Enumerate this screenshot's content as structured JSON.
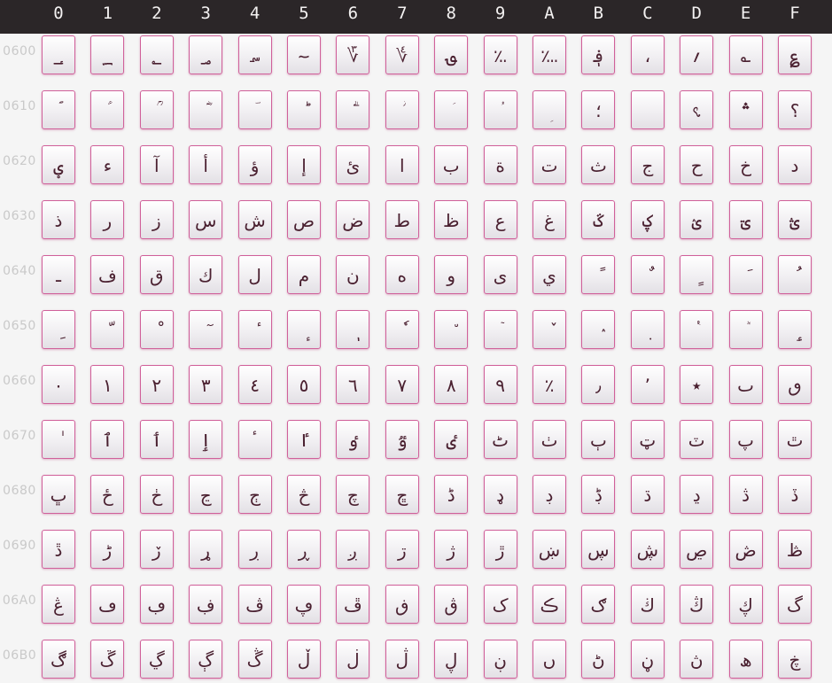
{
  "columns": [
    "0",
    "1",
    "2",
    "3",
    "4",
    "5",
    "6",
    "7",
    "8",
    "9",
    "A",
    "B",
    "C",
    "D",
    "E",
    "F"
  ],
  "rows": [
    {
      "label": "0600",
      "glyphs": [
        "؀",
        "؁",
        "؂",
        "؃",
        "؄",
        "؅",
        "؆",
        "؇",
        "؈",
        "؉",
        "؊",
        "؋",
        "،",
        "؍",
        "؎",
        "؏"
      ]
    },
    {
      "label": "0610",
      "glyphs": [
        "ؐ",
        "ؑ",
        "ؒ",
        "ؓ",
        "ؔ",
        "ؕ",
        "ؖ",
        "ؗ",
        "ؘ",
        "ؙ",
        "ؚ",
        "؛",
        "؜",
        "؝",
        "؞",
        "؟"
      ]
    },
    {
      "label": "0620",
      "glyphs": [
        "ؠ",
        "ء",
        "آ",
        "أ",
        "ؤ",
        "إ",
        "ئ",
        "ا",
        "ب",
        "ة",
        "ت",
        "ث",
        "ج",
        "ح",
        "خ",
        "د"
      ]
    },
    {
      "label": "0630",
      "glyphs": [
        "ذ",
        "ر",
        "ز",
        "س",
        "ش",
        "ص",
        "ض",
        "ط",
        "ظ",
        "ع",
        "غ",
        "ػ",
        "ؼ",
        "ؽ",
        "ؾ",
        "ؿ"
      ]
    },
    {
      "label": "0640",
      "glyphs": [
        "ـ",
        "ف",
        "ق",
        "ك",
        "ل",
        "م",
        "ن",
        "ه",
        "و",
        "ى",
        "ي",
        "ً",
        "ٌ",
        "ٍ",
        "َ",
        "ُ"
      ]
    },
    {
      "label": "0650",
      "glyphs": [
        "ِ",
        "ّ",
        "ْ",
        "ٓ",
        "ٔ",
        "ٕ",
        "ٖ",
        "ٗ",
        "٘",
        "ٙ",
        "ٚ",
        "ٛ",
        "ٜ",
        "ٝ",
        "ٞ",
        "ٟ"
      ]
    },
    {
      "label": "0660",
      "glyphs": [
        "٠",
        "١",
        "٢",
        "٣",
        "٤",
        "٥",
        "٦",
        "٧",
        "٨",
        "٩",
        "٪",
        "٫",
        "٬",
        "٭",
        "ٮ",
        "ٯ"
      ]
    },
    {
      "label": "0670",
      "glyphs": [
        "ٰ",
        "ٱ",
        "ٲ",
        "ٳ",
        "ٴ",
        "ٵ",
        "ٶ",
        "ٷ",
        "ٸ",
        "ٹ",
        "ٺ",
        "ٻ",
        "ټ",
        "ٽ",
        "پ",
        "ٿ"
      ]
    },
    {
      "label": "0680",
      "glyphs": [
        "ڀ",
        "ځ",
        "ڂ",
        "ڃ",
        "ڄ",
        "څ",
        "چ",
        "ڇ",
        "ڈ",
        "ډ",
        "ڊ",
        "ڋ",
        "ڌ",
        "ڍ",
        "ڎ",
        "ڏ"
      ]
    },
    {
      "label": "0690",
      "glyphs": [
        "ڐ",
        "ڑ",
        "ڒ",
        "ړ",
        "ڔ",
        "ڕ",
        "ږ",
        "ڗ",
        "ژ",
        "ڙ",
        "ښ",
        "ڛ",
        "ڜ",
        "ڝ",
        "ڞ",
        "ڟ"
      ]
    },
    {
      "label": "06A0",
      "glyphs": [
        "ڠ",
        "ڡ",
        "ڢ",
        "ڣ",
        "ڤ",
        "ڥ",
        "ڦ",
        "ڧ",
        "ڨ",
        "ک",
        "ڪ",
        "ګ",
        "ڬ",
        "ڭ",
        "ڮ",
        "گ"
      ]
    },
    {
      "label": "06B0",
      "glyphs": [
        "ڰ",
        "ڱ",
        "ڲ",
        "ڳ",
        "ڴ",
        "ڵ",
        "ڶ",
        "ڷ",
        "ڸ",
        "ڹ",
        "ں",
        "ڻ",
        "ڼ",
        "ڽ",
        "ھ",
        "ڿ"
      ]
    }
  ],
  "colors": {
    "header_bg": "#2b2628",
    "header_text": "#f4f2f2",
    "row_label": "#c9c9c9",
    "cell_border": "#d0609a",
    "glyph": "#4a2030"
  }
}
